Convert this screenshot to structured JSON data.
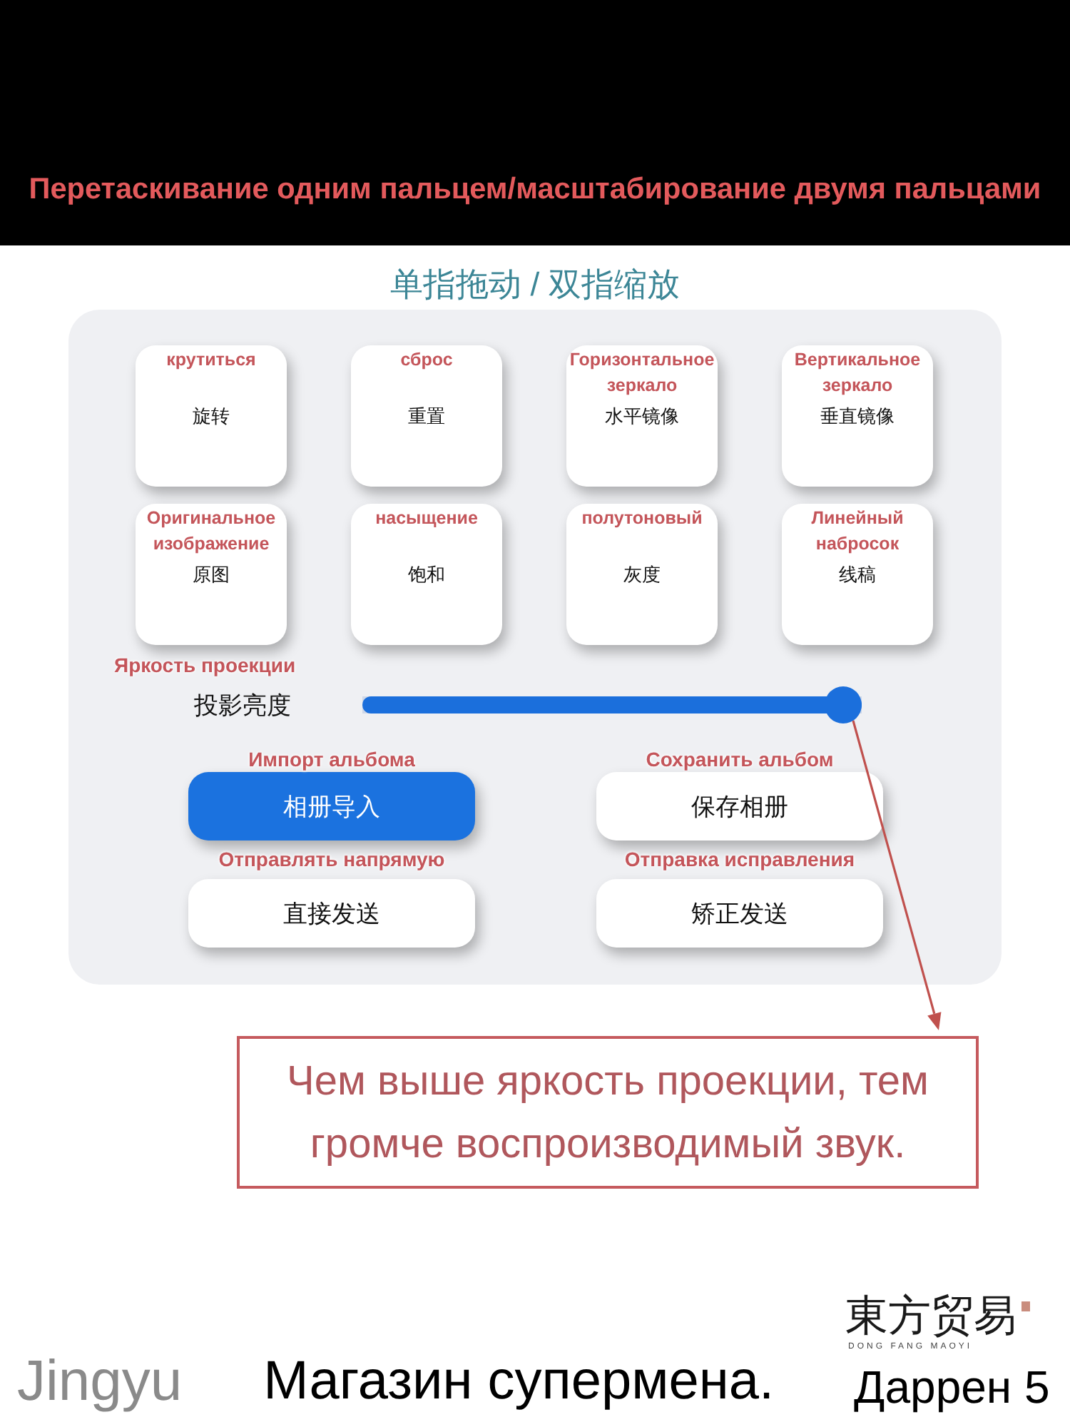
{
  "banner": {
    "title": "Перетаскивание одним пальцем/масштабирование двумя пальцами"
  },
  "subtitle": "单指拖动 / 双指缩放",
  "panel": {
    "tiles": [
      {
        "caption": "крутиться",
        "label": "旋转"
      },
      {
        "caption": "сброс",
        "label": "重置"
      },
      {
        "caption": "Горизонтальное зеркало",
        "label": "水平镜像"
      },
      {
        "caption": "Вертикальное зеркало",
        "label": "垂直镜像"
      },
      {
        "caption": "Оригинальное изображение",
        "label": "原图"
      },
      {
        "caption": "насыщение",
        "label": "饱和"
      },
      {
        "caption": "полутоновый",
        "label": "灰度"
      },
      {
        "caption": "Линейный набросок",
        "label": "线稿"
      }
    ],
    "brightness": {
      "caption": "Яркость проекции",
      "label": "投影亮度",
      "level": 1
    },
    "buttons": [
      {
        "caption": "Импорт альбома",
        "label": "相册导入",
        "selected": true
      },
      {
        "caption": "Сохранить альбом",
        "label": "保存相册",
        "selected": false
      },
      {
        "caption": "Отправлять напрямую",
        "label": "直接发送",
        "selected": false
      },
      {
        "caption": "Отправка исправления",
        "label": "矫正发送",
        "selected": false
      }
    ]
  },
  "callout": {
    "text": "Чем выше яркость проекции, тем громче воспроизводимый звук."
  },
  "footer": {
    "brand": "Jingyu",
    "shop": "Магазин супермена.",
    "tag": "Даррен 5",
    "logo": {
      "mark": "東方贸易",
      "romanized": "DONG FANG MAOYI"
    }
  }
}
